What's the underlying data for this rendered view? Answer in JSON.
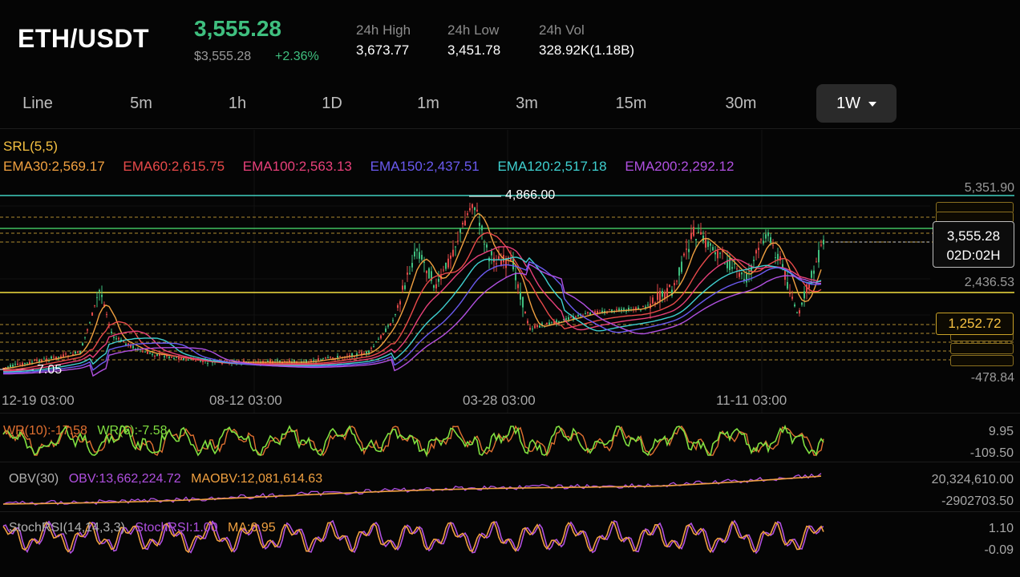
{
  "header": {
    "pair": "ETH/USDT",
    "last_price": "3,555.28",
    "usd_price": "$3,555.28",
    "change": "+2.36%",
    "stats": [
      {
        "label": "24h High",
        "value": "3,673.77"
      },
      {
        "label": "24h Low",
        "value": "3,451.78"
      },
      {
        "label": "24h Vol",
        "value": "328.92K(1.18B)"
      }
    ]
  },
  "intervals": {
    "items": [
      "Line",
      "5m",
      "1h",
      "1D",
      "1m",
      "3m",
      "15m",
      "30m"
    ],
    "active": "1W"
  },
  "indicators": {
    "srl": "SRL(5,5)",
    "ema": [
      {
        "text": "EMA30:2,569.17",
        "color": "#f0a040"
      },
      {
        "text": "EMA60:2,615.75",
        "color": "#e84a4a"
      },
      {
        "text": "EMA100:2,563.13",
        "color": "#e8407a"
      },
      {
        "text": "EMA150:2,437.51",
        "color": "#6a5af0"
      },
      {
        "text": "EMA120:2,517.18",
        "color": "#3fd0d0"
      },
      {
        "text": "EMA200:2,292.12",
        "color": "#b050e0"
      }
    ]
  },
  "main_chart": {
    "y_axis": [
      "5,351.90",
      "2,436.53",
      "-478.84"
    ],
    "high_marker": "4,866.00",
    "low_marker": "7.05",
    "current_price": "3,555.28",
    "countdown": "02D:02H",
    "support_label": "1,252.72",
    "dates": [
      "12-19 03:00",
      "08-12 03:00",
      "03-28 03:00",
      "11-11 03:00"
    ]
  },
  "wr_panel": {
    "label": "WR(10):-17.58",
    "label2": "WR(6):-7.58",
    "y_top": "9.95",
    "y_bottom": "-109.50"
  },
  "obv_panel": {
    "label": "OBV(30)",
    "obv": "OBV:13,662,224.72",
    "maobv": "MAOBV:12,081,614.63",
    "y_top": "20,324,610.00",
    "y_bottom": "-2902703.50"
  },
  "stoch_panel": {
    "label": "StochRSI(14,14,3,3)",
    "stoch": "StochRSI:1.00",
    "ma": "MA:0.95",
    "y_top": "1.10",
    "y_bottom": "-0.09"
  },
  "colors": {
    "up": "#3fbf7f",
    "down": "#e04848",
    "accent_yellow": "#f5c142",
    "teal_line": "#40d0c0",
    "green_line": "#40c060"
  }
}
